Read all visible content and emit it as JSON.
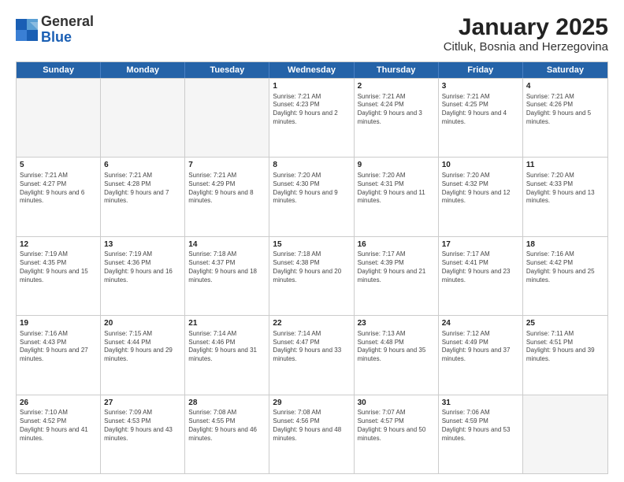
{
  "header": {
    "logo_general": "General",
    "logo_blue": "Blue",
    "title": "January 2025",
    "subtitle": "Citluk, Bosnia and Herzegovina"
  },
  "days_of_week": [
    "Sunday",
    "Monday",
    "Tuesday",
    "Wednesday",
    "Thursday",
    "Friday",
    "Saturday"
  ],
  "weeks": [
    [
      {
        "day": "",
        "empty": true
      },
      {
        "day": "",
        "empty": true
      },
      {
        "day": "",
        "empty": true
      },
      {
        "day": "1",
        "sunrise": "7:21 AM",
        "sunset": "4:23 PM",
        "daylight": "9 hours and 2 minutes."
      },
      {
        "day": "2",
        "sunrise": "7:21 AM",
        "sunset": "4:24 PM",
        "daylight": "9 hours and 3 minutes."
      },
      {
        "day": "3",
        "sunrise": "7:21 AM",
        "sunset": "4:25 PM",
        "daylight": "9 hours and 4 minutes."
      },
      {
        "day": "4",
        "sunrise": "7:21 AM",
        "sunset": "4:26 PM",
        "daylight": "9 hours and 5 minutes."
      }
    ],
    [
      {
        "day": "5",
        "sunrise": "7:21 AM",
        "sunset": "4:27 PM",
        "daylight": "9 hours and 6 minutes."
      },
      {
        "day": "6",
        "sunrise": "7:21 AM",
        "sunset": "4:28 PM",
        "daylight": "9 hours and 7 minutes."
      },
      {
        "day": "7",
        "sunrise": "7:21 AM",
        "sunset": "4:29 PM",
        "daylight": "9 hours and 8 minutes."
      },
      {
        "day": "8",
        "sunrise": "7:20 AM",
        "sunset": "4:30 PM",
        "daylight": "9 hours and 9 minutes."
      },
      {
        "day": "9",
        "sunrise": "7:20 AM",
        "sunset": "4:31 PM",
        "daylight": "9 hours and 11 minutes."
      },
      {
        "day": "10",
        "sunrise": "7:20 AM",
        "sunset": "4:32 PM",
        "daylight": "9 hours and 12 minutes."
      },
      {
        "day": "11",
        "sunrise": "7:20 AM",
        "sunset": "4:33 PM",
        "daylight": "9 hours and 13 minutes."
      }
    ],
    [
      {
        "day": "12",
        "sunrise": "7:19 AM",
        "sunset": "4:35 PM",
        "daylight": "9 hours and 15 minutes."
      },
      {
        "day": "13",
        "sunrise": "7:19 AM",
        "sunset": "4:36 PM",
        "daylight": "9 hours and 16 minutes."
      },
      {
        "day": "14",
        "sunrise": "7:18 AM",
        "sunset": "4:37 PM",
        "daylight": "9 hours and 18 minutes."
      },
      {
        "day": "15",
        "sunrise": "7:18 AM",
        "sunset": "4:38 PM",
        "daylight": "9 hours and 20 minutes."
      },
      {
        "day": "16",
        "sunrise": "7:17 AM",
        "sunset": "4:39 PM",
        "daylight": "9 hours and 21 minutes."
      },
      {
        "day": "17",
        "sunrise": "7:17 AM",
        "sunset": "4:41 PM",
        "daylight": "9 hours and 23 minutes."
      },
      {
        "day": "18",
        "sunrise": "7:16 AM",
        "sunset": "4:42 PM",
        "daylight": "9 hours and 25 minutes."
      }
    ],
    [
      {
        "day": "19",
        "sunrise": "7:16 AM",
        "sunset": "4:43 PM",
        "daylight": "9 hours and 27 minutes."
      },
      {
        "day": "20",
        "sunrise": "7:15 AM",
        "sunset": "4:44 PM",
        "daylight": "9 hours and 29 minutes."
      },
      {
        "day": "21",
        "sunrise": "7:14 AM",
        "sunset": "4:46 PM",
        "daylight": "9 hours and 31 minutes."
      },
      {
        "day": "22",
        "sunrise": "7:14 AM",
        "sunset": "4:47 PM",
        "daylight": "9 hours and 33 minutes."
      },
      {
        "day": "23",
        "sunrise": "7:13 AM",
        "sunset": "4:48 PM",
        "daylight": "9 hours and 35 minutes."
      },
      {
        "day": "24",
        "sunrise": "7:12 AM",
        "sunset": "4:49 PM",
        "daylight": "9 hours and 37 minutes."
      },
      {
        "day": "25",
        "sunrise": "7:11 AM",
        "sunset": "4:51 PM",
        "daylight": "9 hours and 39 minutes."
      }
    ],
    [
      {
        "day": "26",
        "sunrise": "7:10 AM",
        "sunset": "4:52 PM",
        "daylight": "9 hours and 41 minutes."
      },
      {
        "day": "27",
        "sunrise": "7:09 AM",
        "sunset": "4:53 PM",
        "daylight": "9 hours and 43 minutes."
      },
      {
        "day": "28",
        "sunrise": "7:08 AM",
        "sunset": "4:55 PM",
        "daylight": "9 hours and 46 minutes."
      },
      {
        "day": "29",
        "sunrise": "7:08 AM",
        "sunset": "4:56 PM",
        "daylight": "9 hours and 48 minutes."
      },
      {
        "day": "30",
        "sunrise": "7:07 AM",
        "sunset": "4:57 PM",
        "daylight": "9 hours and 50 minutes."
      },
      {
        "day": "31",
        "sunrise": "7:06 AM",
        "sunset": "4:59 PM",
        "daylight": "9 hours and 53 minutes."
      },
      {
        "day": "",
        "empty": true
      }
    ]
  ]
}
